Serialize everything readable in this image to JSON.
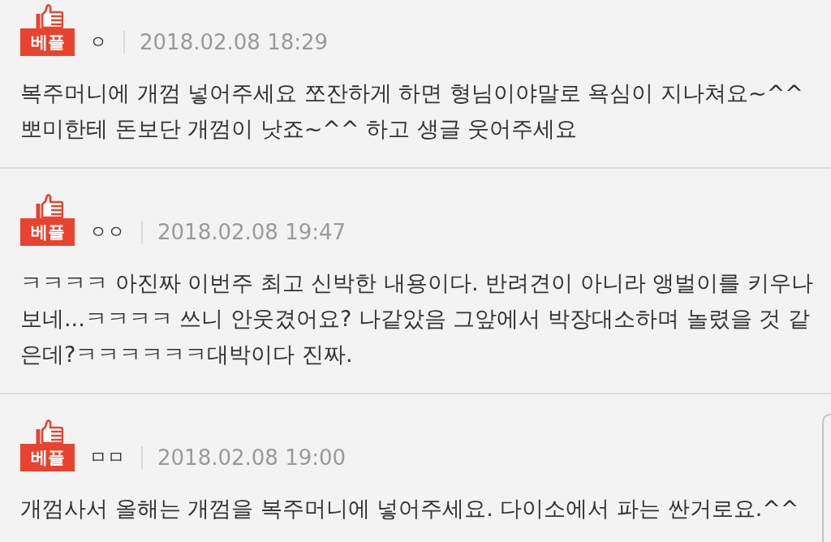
{
  "comments": [
    {
      "badge": "베플",
      "author": "ㅇ",
      "date": "2018.02.08 18:29",
      "text": "복주머니에 개껌 넣어주세요 쪼잔하게 하면 형님이야말로 욕심이 지나쳐요~^^ 뽀미한테 돈보단 개껌이 낫죠~^^ 하고 생글 웃어주세요"
    },
    {
      "badge": "베플",
      "author": "ㅇㅇ",
      "date": "2018.02.08 19:47",
      "text": "ㅋㅋㅋㅋ 아진짜 이번주 최고 신박한 내용이다. 반려견이 아니라 앵벌이를 키우나보네...ㅋㅋㅋㅋ 쓰니 안웃겼어요? 나같았음 그앞에서 박장대소하며 놀렸을 것 같은데?ㅋㅋㅋㅋㅋㅋ대박이다 진짜."
    },
    {
      "badge": "베플",
      "author": "ㅁㅁ",
      "date": "2018.02.08 19:00",
      "text": "개껌사서 올해는 개껌을 복주머니에 넣어주세요. 다이소에서 파는 싼거로요.^^"
    }
  ]
}
